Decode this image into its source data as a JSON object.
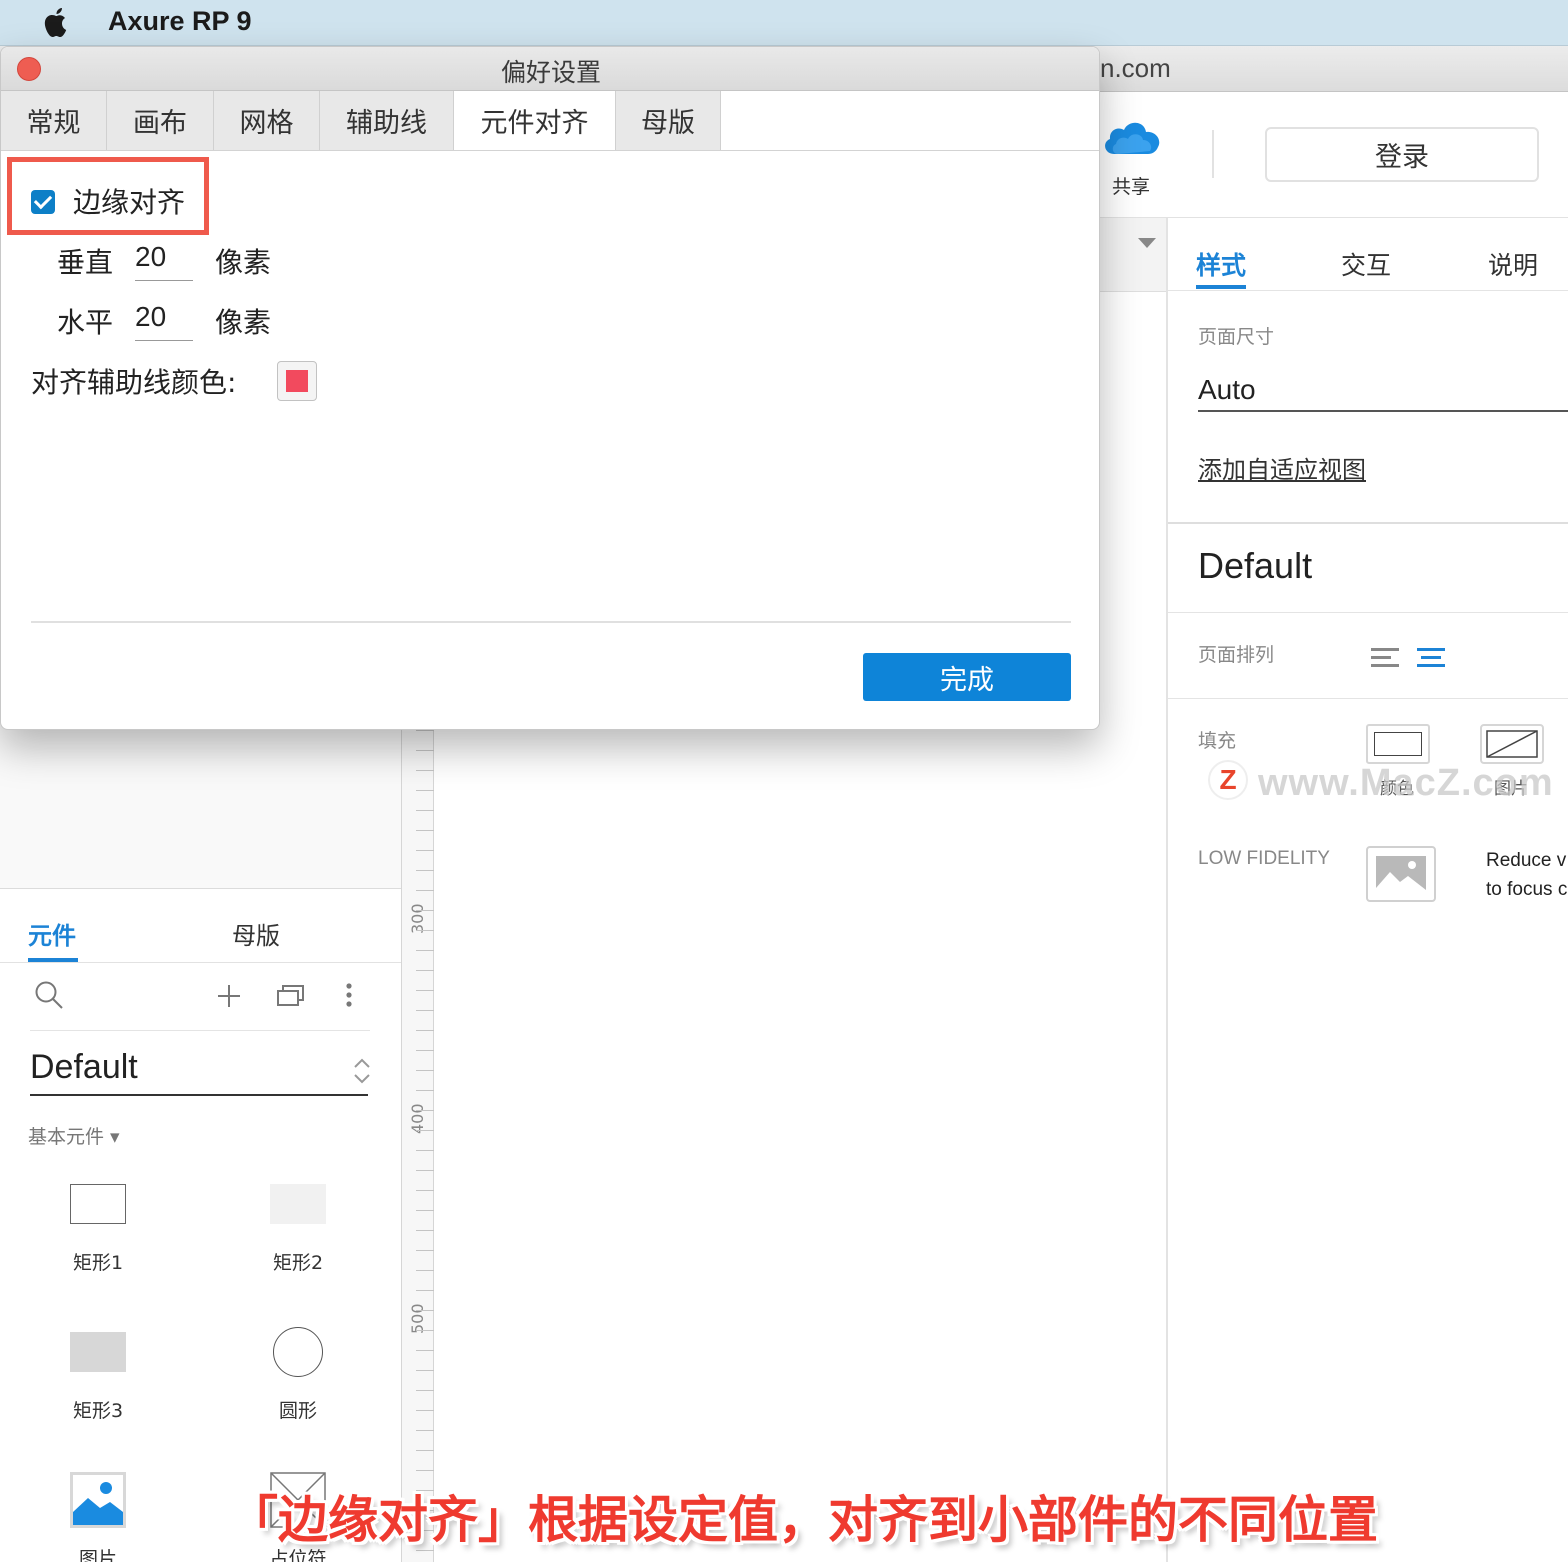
{
  "menubar": {
    "app_name": "Axure RP 9"
  },
  "window": {
    "url_fragment": "n.com"
  },
  "toolbar": {
    "share_label": "共享",
    "login_label": "登录"
  },
  "dialog": {
    "title": "偏好设置",
    "tabs": [
      {
        "label": "常规",
        "active": false
      },
      {
        "label": "画布",
        "active": false
      },
      {
        "label": "网格",
        "active": false
      },
      {
        "label": "辅助线",
        "active": false
      },
      {
        "label": "元件对齐",
        "active": true
      },
      {
        "label": "母版",
        "active": false
      }
    ],
    "edge_snap": {
      "label": "边缘对齐",
      "checked": true
    },
    "vertical": {
      "label": "垂直",
      "value": "20",
      "unit": "像素"
    },
    "horizontal": {
      "label": "水平",
      "value": "20",
      "unit": "像素"
    },
    "guide_color": {
      "label": "对齐辅助线颜色:",
      "color": "#f24a5e"
    },
    "done_label": "完成"
  },
  "left_panel": {
    "tabs": [
      {
        "label": "元件",
        "active": true
      },
      {
        "label": "母版",
        "active": false
      }
    ],
    "library": "Default",
    "category": "基本元件 ▾",
    "widgets": [
      {
        "label": "矩形1"
      },
      {
        "label": "矩形2"
      },
      {
        "label": "矩形3"
      },
      {
        "label": "圆形"
      },
      {
        "label": "图片"
      },
      {
        "label": "占位符"
      }
    ]
  },
  "ruler": {
    "labels": [
      "300",
      "400",
      "500"
    ]
  },
  "inspector": {
    "tabs": [
      {
        "label": "样式",
        "active": true
      },
      {
        "label": "交互",
        "active": false
      },
      {
        "label": "说明",
        "active": false
      }
    ],
    "page_size_label": "页面尺寸",
    "page_size_value": "Auto",
    "add_adaptive_link": "添加自适应视图",
    "style_name": "Default",
    "page_align_label": "页面排列",
    "fill_label": "填充",
    "fill_options": [
      "颜色",
      "图片"
    ],
    "low_fidelity_label": "LOW FIDELITY",
    "low_fidelity_desc_1": "Reduce v",
    "low_fidelity_desc_2": "to focus c"
  },
  "watermark": "www.MacZ.com",
  "caption": "「边缘对齐」根据设定值，对齐到小部件的不同位置",
  "colors": {
    "accent": "#1c83d6",
    "button": "#0e84d8",
    "highlight": "#ef5a4c",
    "caption": "#ef3a2f"
  }
}
